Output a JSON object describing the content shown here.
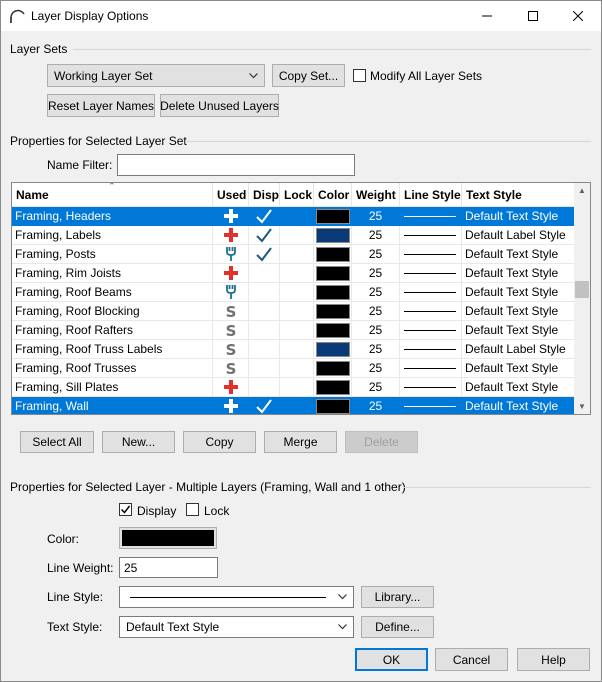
{
  "window": {
    "title": "Layer Display Options"
  },
  "layer_sets": {
    "group_label": "Layer Sets",
    "selected_set": "Working Layer Set",
    "copy_set_label": "Copy Set...",
    "modify_all_label": "Modify All Layer Sets",
    "modify_all_checked": false,
    "reset_names_label": "Reset Layer Names",
    "delete_unused_label": "Delete Unused Layers"
  },
  "properties_set": {
    "group_label": "Properties for Selected Layer Set",
    "name_filter_label": "Name Filter:",
    "name_filter_value": ""
  },
  "table": {
    "columns": [
      "Name",
      "Used",
      "Disp",
      "Lock",
      "Color",
      "Weight",
      "Line Style",
      "Text Style"
    ],
    "rows": [
      {
        "name": "Framing, Headers",
        "used": "plus",
        "disp": true,
        "lock": false,
        "color": "#000000",
        "weight": "25",
        "text_style": "Default Text Style",
        "selected": true
      },
      {
        "name": "Framing, Labels",
        "used": "plus",
        "disp": true,
        "lock": false,
        "color": "#0a3a78",
        "weight": "25",
        "text_style": "Default Label Style",
        "selected": false
      },
      {
        "name": "Framing, Posts",
        "used": "wrench",
        "disp": true,
        "lock": false,
        "color": "#000000",
        "weight": "25",
        "text_style": "Default Text Style",
        "selected": false
      },
      {
        "name": "Framing, Rim Joists",
        "used": "plus",
        "disp": false,
        "lock": false,
        "color": "#000000",
        "weight": "25",
        "text_style": "Default Text Style",
        "selected": false
      },
      {
        "name": "Framing, Roof Beams",
        "used": "wrench",
        "disp": false,
        "lock": false,
        "color": "#000000",
        "weight": "25",
        "text_style": "Default Text Style",
        "selected": false
      },
      {
        "name": "Framing, Roof Blocking",
        "used": "s",
        "disp": false,
        "lock": false,
        "color": "#000000",
        "weight": "25",
        "text_style": "Default Text Style",
        "selected": false
      },
      {
        "name": "Framing, Roof Rafters",
        "used": "s",
        "disp": false,
        "lock": false,
        "color": "#000000",
        "weight": "25",
        "text_style": "Default Text Style",
        "selected": false
      },
      {
        "name": "Framing, Roof Truss Labels",
        "used": "s",
        "disp": false,
        "lock": false,
        "color": "#0a3a78",
        "weight": "25",
        "text_style": "Default Label Style",
        "selected": false
      },
      {
        "name": "Framing, Roof Trusses",
        "used": "s",
        "disp": false,
        "lock": false,
        "color": "#000000",
        "weight": "25",
        "text_style": "Default Text Style",
        "selected": false
      },
      {
        "name": "Framing, Sill Plates",
        "used": "plus",
        "disp": false,
        "lock": false,
        "color": "#000000",
        "weight": "25",
        "text_style": "Default Text Style",
        "selected": false
      },
      {
        "name": "Framing, Wall",
        "used": "plus",
        "disp": true,
        "lock": false,
        "color": "#000000",
        "weight": "25",
        "text_style": "Default Text Style",
        "selected": true
      }
    ]
  },
  "table_buttons": {
    "select_all": "Select All",
    "new": "New...",
    "copy": "Copy",
    "merge": "Merge",
    "delete": "Delete"
  },
  "properties_layer": {
    "group_label": "Properties for Selected Layer - Multiple Layers (Framing, Wall and 1 other)",
    "display_label": "Display",
    "display_checked": true,
    "lock_label": "Lock",
    "lock_checked": false,
    "color_label": "Color:",
    "color_value": "#000000",
    "line_weight_label": "Line Weight:",
    "line_weight_value": "25",
    "line_style_label": "Line Style:",
    "library_label": "Library...",
    "text_style_label": "Text Style:",
    "text_style_value": "Default Text Style",
    "define_label": "Define..."
  },
  "footer": {
    "ok": "OK",
    "cancel": "Cancel",
    "help": "Help"
  },
  "colors": {
    "selection": "#0078d7",
    "plus_icon": "#e0312b",
    "teal_icon": "#1b6f8e",
    "s_icon": "#707070",
    "check_icon": "#1b5a7e"
  }
}
